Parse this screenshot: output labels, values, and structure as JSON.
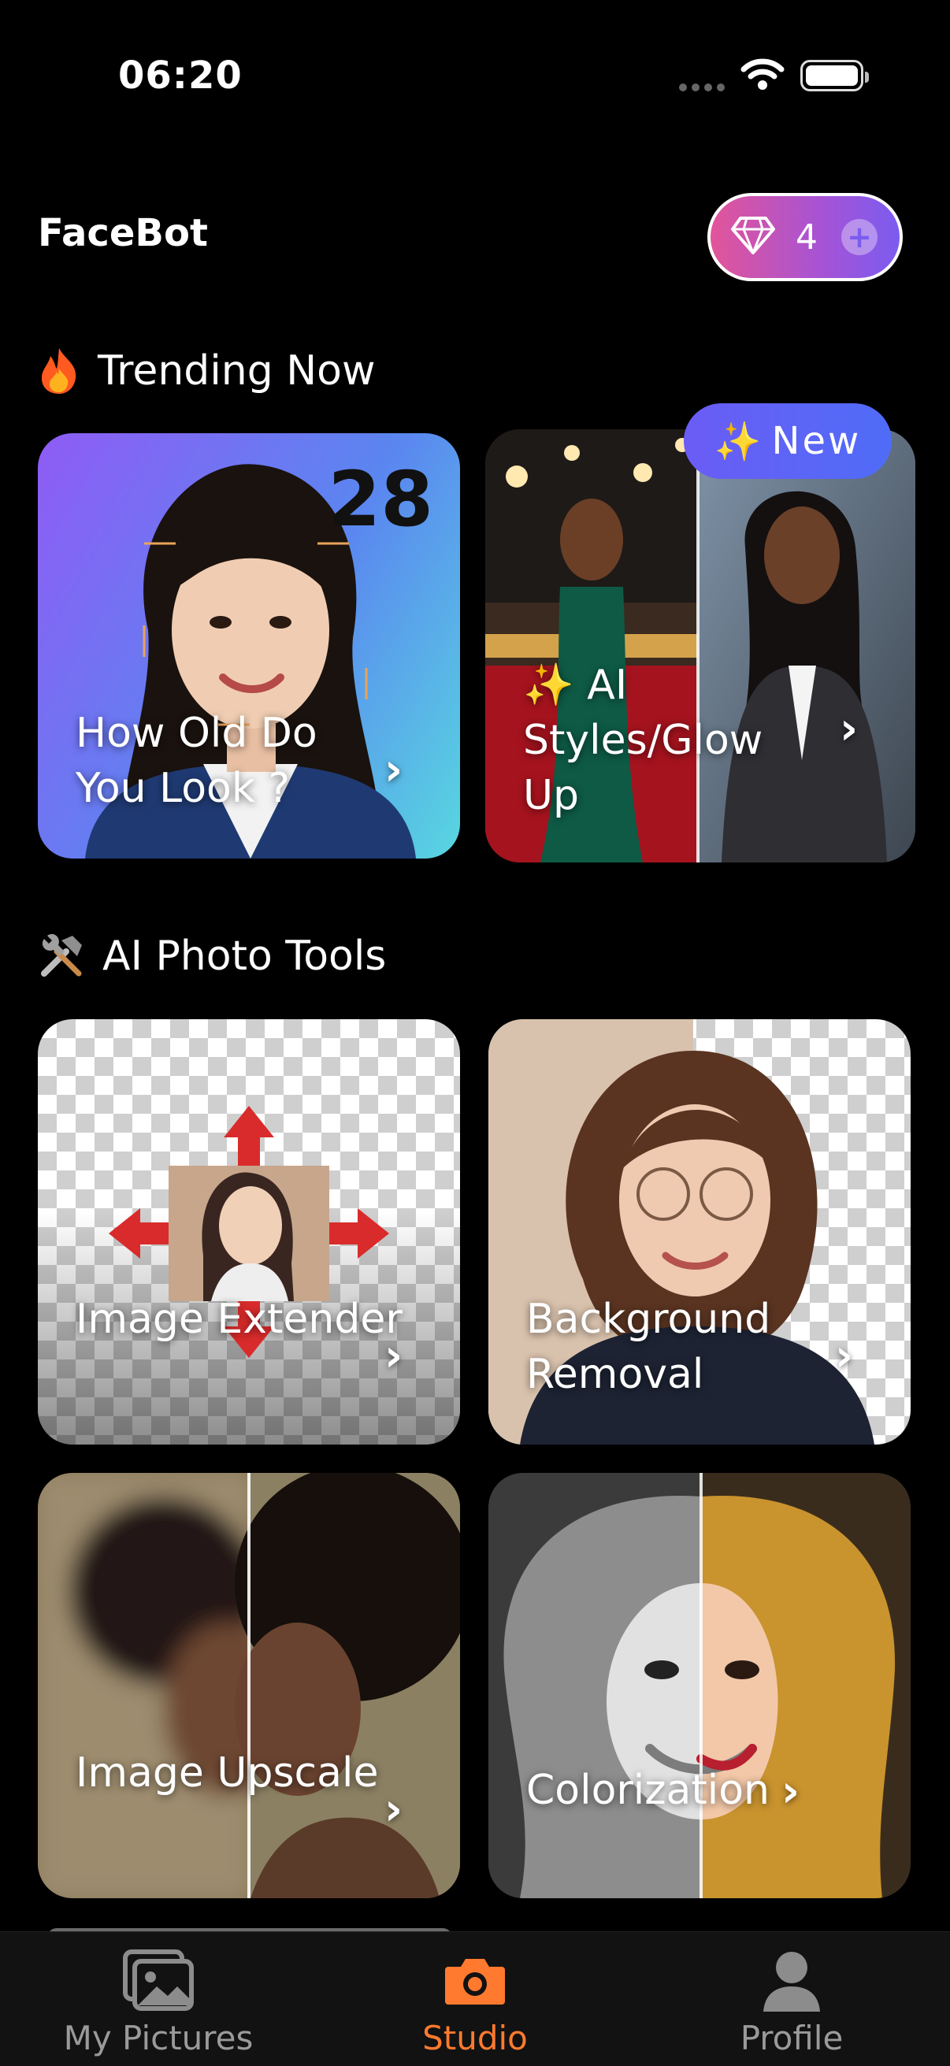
{
  "status_bar": {
    "time": "06:20"
  },
  "header": {
    "app_title": "FaceBot",
    "gems": "4"
  },
  "trending": {
    "title": "Trending Now",
    "cards": [
      {
        "label": "How Old Do You Look ?",
        "age_number": "28"
      },
      {
        "label": "✨ AI Styles/Glow Up",
        "badge": "New"
      }
    ]
  },
  "tools": {
    "title": "AI Photo Tools",
    "cards": [
      {
        "label": "Image Extender"
      },
      {
        "label": "Background Removal"
      },
      {
        "label": "Image Upscale"
      },
      {
        "label": "Colorization"
      }
    ]
  },
  "tabbar": {
    "tabs": [
      {
        "label": "My Pictures",
        "icon": "pictures-icon"
      },
      {
        "label": "Studio",
        "icon": "camera-icon",
        "active": true
      },
      {
        "label": "Profile",
        "icon": "profile-icon"
      }
    ]
  },
  "colors": {
    "accent": "#ff7a2f",
    "badge": "#6b5cf6",
    "gem_pill_start": "#e2559a"
  }
}
